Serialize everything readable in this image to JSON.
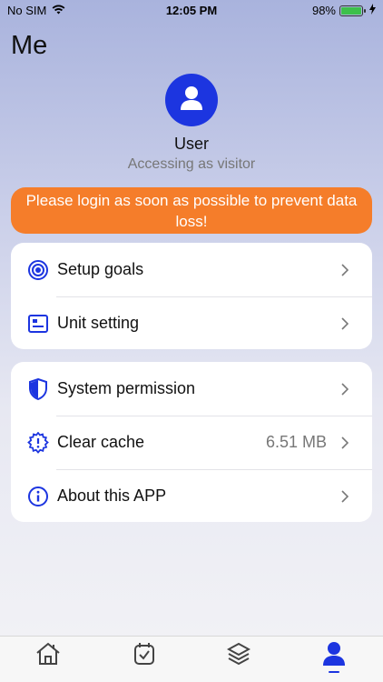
{
  "status_bar": {
    "carrier": "No SIM",
    "time": "12:05 PM",
    "battery": "98%",
    "battery_level": 0.98
  },
  "header": {
    "title": "Me"
  },
  "profile": {
    "name": "User",
    "subtitle": "Accessing as visitor"
  },
  "banner": {
    "text": "Please login as soon as possible to prevent data loss!"
  },
  "settings_group_1": [
    {
      "label": "Setup goals",
      "icon": "target-icon"
    },
    {
      "label": "Unit setting",
      "icon": "unit-card-icon"
    }
  ],
  "settings_group_2": [
    {
      "label": "System permission",
      "icon": "shield-icon"
    },
    {
      "label": "Clear cache",
      "icon": "gear-alert-icon",
      "value": "6.51 MB"
    },
    {
      "label": "About this APP",
      "icon": "info-icon"
    }
  ],
  "tab_bar": {
    "tabs": [
      "home-icon",
      "clock-calendar-icon",
      "layers-icon",
      "user-icon"
    ],
    "active": "user-icon"
  },
  "colors": {
    "accent": "#1c35e0",
    "banner": "#f57d2a"
  }
}
